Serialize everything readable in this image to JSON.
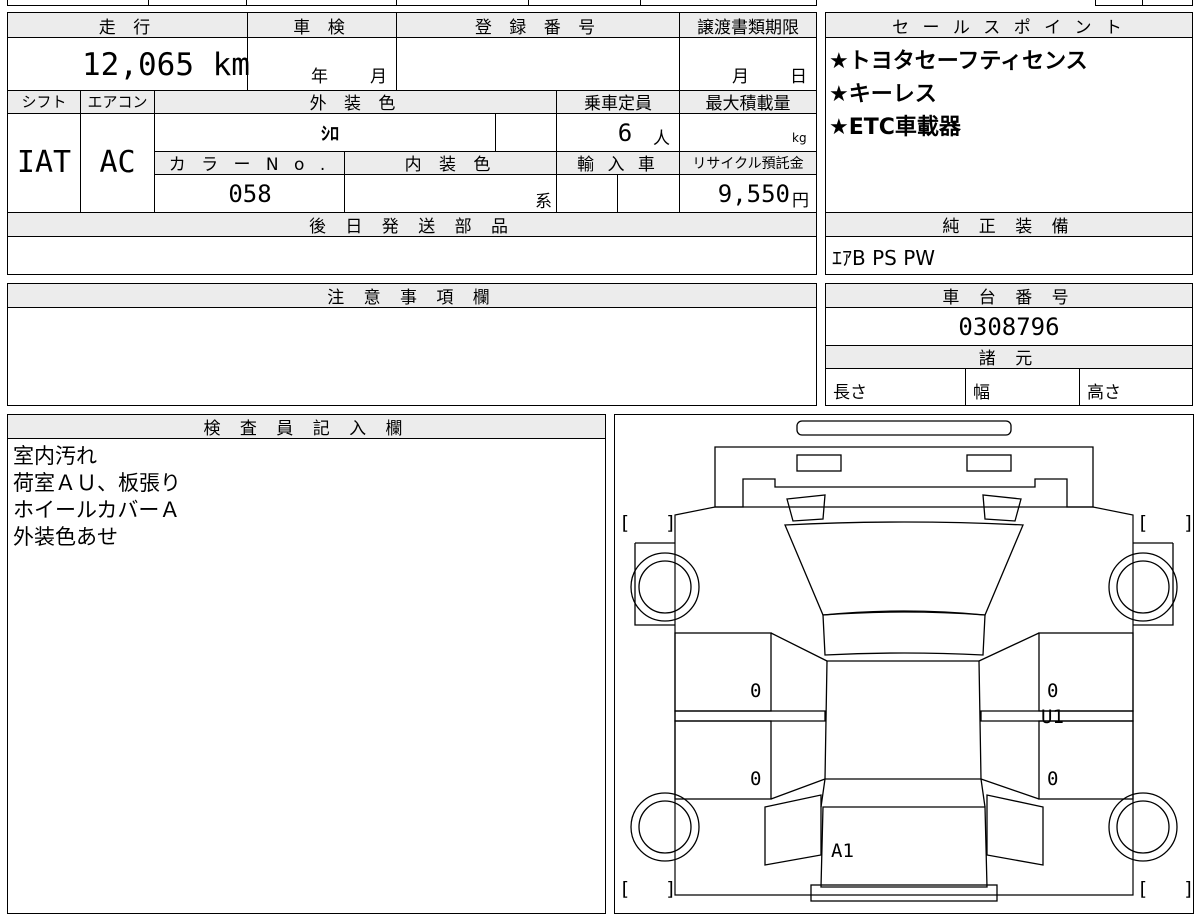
{
  "headers": {
    "mileage": "走 行",
    "inspection": "車 検",
    "registration_no": "登 録 番 号",
    "transfer_deadline": "譲渡書類期限",
    "sales_points": "セ ー ル ス ポ イ ン ト",
    "shift": "シフト",
    "aircon": "エアコン",
    "exterior_color": "外 装 色",
    "capacity": "乗車定員",
    "max_load": "最大積載量",
    "color_no": "カ ラ ー N o .",
    "interior_color": "内 装 色",
    "import": "輸 入 車",
    "recycle_fee": "リサイクル預託金",
    "later_parts": "後 日 発 送 部 品",
    "oem_equipment": "純 正 装 備",
    "cautions": "注 意 事 項 欄",
    "chassis_no": "車 台 番 号",
    "specs": "諸 元",
    "inspector_notes": "検 査 員 記 入 欄"
  },
  "values": {
    "mileage": "12,065 km",
    "inspection_year_unit": "年",
    "inspection_month_unit": "月",
    "transfer_month_unit": "月",
    "transfer_day_unit": "日",
    "shift": "IAT",
    "aircon": "AC",
    "exterior_color": "ｼﾛ",
    "capacity": "6",
    "capacity_unit": "人",
    "max_load_unit": "kg",
    "color_no": "058",
    "interior_color_suffix": "系",
    "recycle_fee": "9,550",
    "recycle_fee_unit": "円",
    "equipment": "ｴｱB PS PW",
    "chassis_no": "0308796",
    "spec_length": "長さ",
    "spec_width": "幅",
    "spec_height": "高さ"
  },
  "sales_points": [
    "★トヨタセーフティセンス",
    "★キーレス",
    "★ETC車載器"
  ],
  "inspector_notes": [
    "室内汚れ",
    "荷室ＡＵ、板張り",
    "ホイールカバーＡ",
    "外装色あせ"
  ],
  "diagram": {
    "marks": {
      "left_front_panel": "0",
      "left_rear_panel": "0",
      "right_front_panel": "0",
      "right_front_panel_grade": "U1",
      "right_rear_panel": "0",
      "cargo_floor": "A1"
    },
    "bracket_open": "[",
    "bracket_close": "]"
  }
}
